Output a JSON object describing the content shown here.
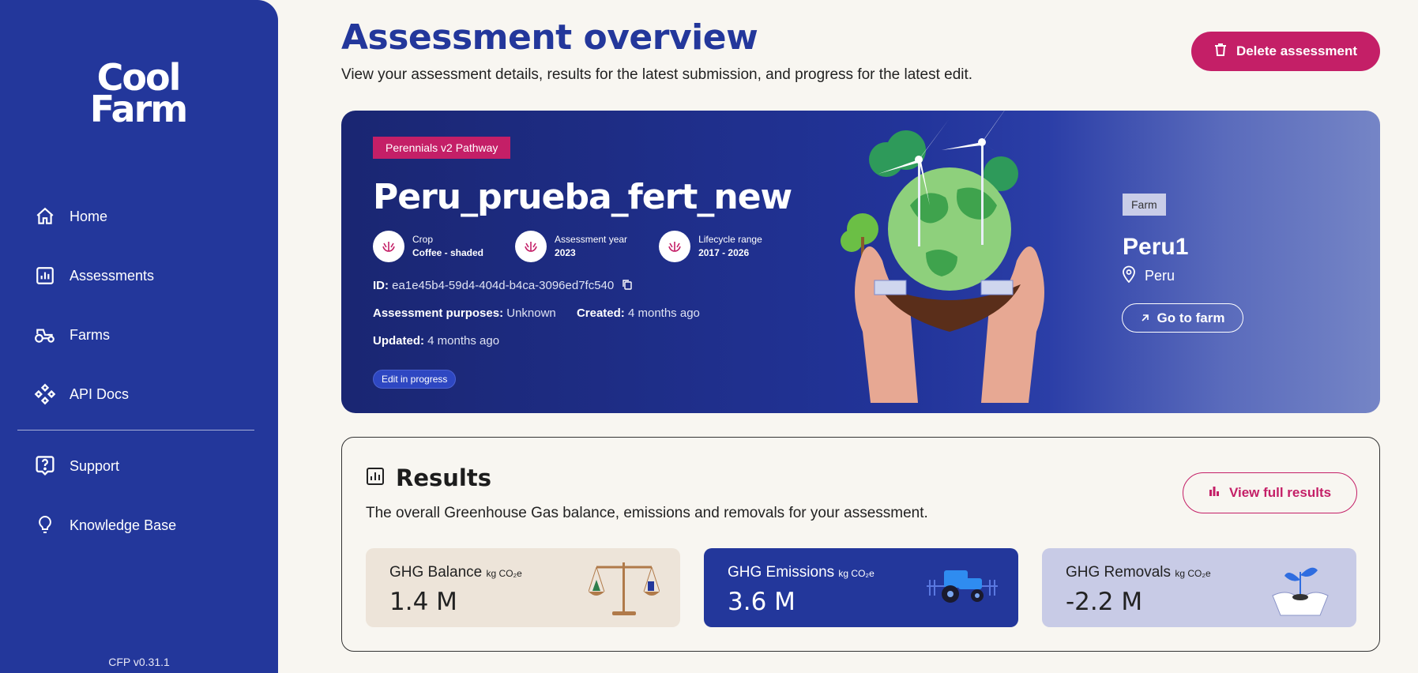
{
  "sidebar": {
    "logo_line1": "Cool",
    "logo_line2": "Farm",
    "items": [
      {
        "label": "Home",
        "icon": "home-icon"
      },
      {
        "label": "Assessments",
        "icon": "chart-icon"
      },
      {
        "label": "Farms",
        "icon": "tractor-icon"
      },
      {
        "label": "API Docs",
        "icon": "api-icon"
      },
      {
        "label": "Support",
        "icon": "help-icon"
      },
      {
        "label": "Knowledge Base",
        "icon": "lightbulb-icon"
      }
    ],
    "version": "CFP v0.31.1"
  },
  "header": {
    "title": "Assessment overview",
    "subtitle": "View your assessment details, results for the latest submission, and progress for the latest edit.",
    "delete_label": "Delete assessment"
  },
  "hero": {
    "pathway": "Perennials v2 Pathway",
    "title": "Peru_prueba_fert_new",
    "crop_label": "Crop",
    "crop_value": "Coffee - shaded",
    "year_label": "Assessment year",
    "year_value": "2023",
    "lifecycle_label": "Lifecycle range",
    "lifecycle_value": "2017 - 2026",
    "id_label": "ID:",
    "id_value": "ea1e45b4-59d4-404d-b4ca-3096ed7fc540",
    "purposes_label": "Assessment purposes:",
    "purposes_value": "Unknown",
    "created_label": "Created:",
    "created_value": "4 months ago",
    "updated_label": "Updated:",
    "updated_value": "4 months ago",
    "status": "Edit in progress",
    "farm_tag": "Farm",
    "farm_name": "Peru1",
    "farm_country": "Peru",
    "farm_button": "Go to farm"
  },
  "results": {
    "title": "Results",
    "subtitle": "The overall Greenhouse Gas balance, emissions and removals for your assessment.",
    "view_button": "View full results",
    "unit": "kg CO₂e",
    "cards": [
      {
        "label": "GHG Balance",
        "value": "1.4 M"
      },
      {
        "label": "GHG Emissions",
        "value": "3.6 M"
      },
      {
        "label": "GHG Removals",
        "value": "-2.2 M"
      }
    ]
  },
  "colors": {
    "brand_blue": "#23379b",
    "accent_pink": "#c41f67",
    "background": "#f8f6f1"
  }
}
